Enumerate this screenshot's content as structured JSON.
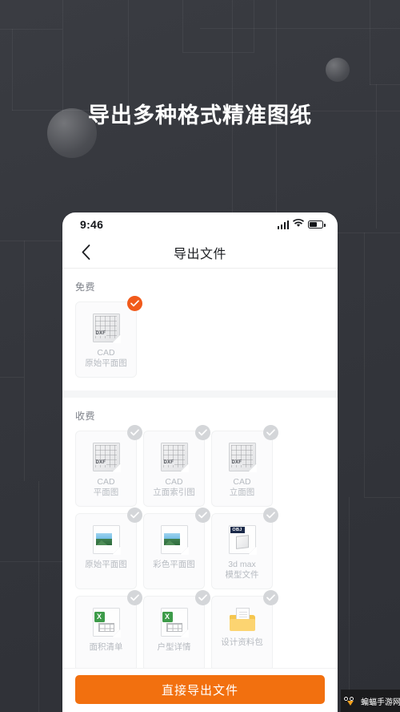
{
  "promo": {
    "title": "导出多种格式精准图纸",
    "bg_color": "#35373d"
  },
  "phone": {
    "statusbar": {
      "time": "9:46",
      "signal_icon": "signal-bars-icon",
      "wifi_icon": "wifi-icon",
      "battery_icon": "battery-icon"
    },
    "navbar": {
      "back_icon": "chevron-left-icon",
      "title": "导出文件"
    },
    "sections": [
      {
        "title": "免费",
        "items": [
          {
            "label": "CAD\n原始平面图",
            "icon": "dxf-file-icon",
            "selected": true
          }
        ]
      },
      {
        "title": "收费",
        "items": [
          {
            "label": "CAD\n平面图",
            "icon": "dxf-file-icon",
            "selected": false
          },
          {
            "label": "CAD\n立面索引图",
            "icon": "dxf-file-icon",
            "selected": false
          },
          {
            "label": "CAD\n立面图",
            "icon": "dxf-file-icon",
            "selected": false
          },
          {
            "label": "原始平面图",
            "icon": "image-file-icon",
            "selected": false
          },
          {
            "label": "彩色平面图",
            "icon": "image-file-icon",
            "selected": false
          },
          {
            "label": "3d max\n模型文件",
            "icon": "obj-file-icon",
            "selected": false
          },
          {
            "label": "面积清单",
            "icon": "excel-file-icon",
            "selected": false
          },
          {
            "label": "户型详情",
            "icon": "excel-file-icon",
            "selected": false
          },
          {
            "label": "设计资料包",
            "icon": "folder-icon",
            "selected": false
          }
        ]
      }
    ],
    "bottombar": {
      "export_label": "直接导出文件",
      "export_color": "#f2700f"
    }
  },
  "watermark": {
    "text": "蝙蝠手游网",
    "logo_icon": "bat-logo-icon"
  }
}
